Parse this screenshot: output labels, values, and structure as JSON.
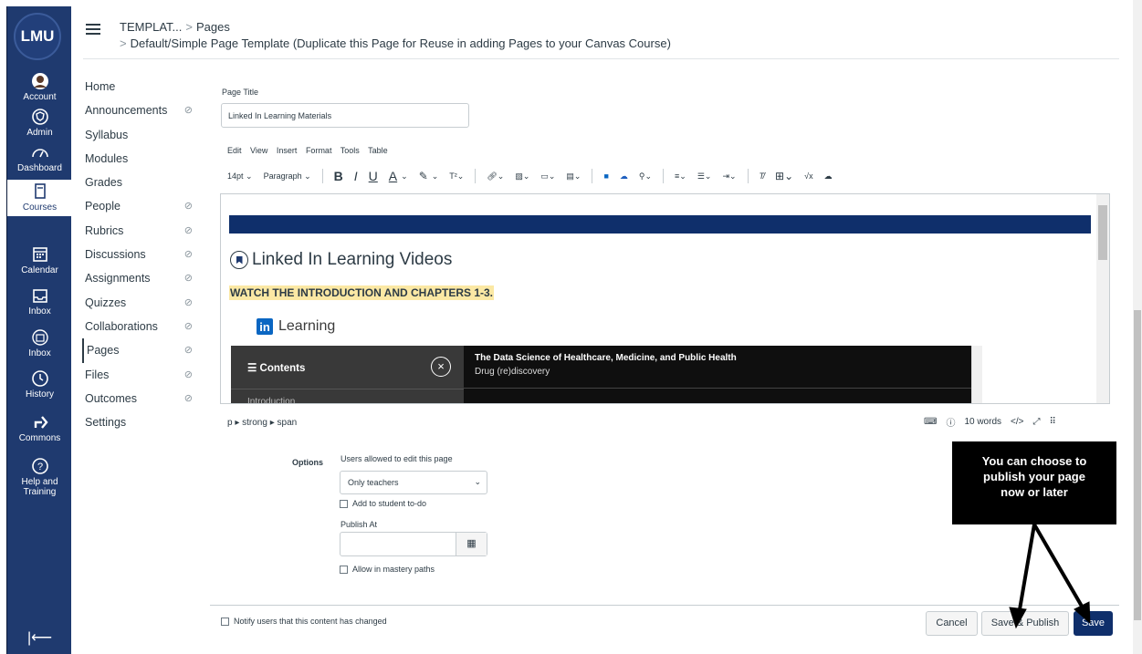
{
  "global_nav": {
    "logo": "LMU",
    "items": [
      {
        "label": "Account",
        "icon": "avatar-icon"
      },
      {
        "label": "Admin",
        "icon": "shield-icon"
      },
      {
        "label": "Dashboard",
        "icon": "dashboard-icon"
      },
      {
        "label": "Courses",
        "icon": "book-icon",
        "active": true
      },
      {
        "label": "Calendar",
        "icon": "calendar-icon"
      },
      {
        "label": "Inbox",
        "icon": "inbox-icon"
      },
      {
        "label": "Inbox",
        "icon": "inbox-icon"
      },
      {
        "label": "History",
        "icon": "clock-icon"
      },
      {
        "label": "Commons",
        "icon": "commons-icon"
      },
      {
        "label": "Help and Training",
        "icon": "help-icon"
      }
    ],
    "collapse": "|⟵"
  },
  "header": {
    "course": "TEMPLAT...",
    "section": "Pages",
    "page": "Default/Simple Page Template (Duplicate this Page for Reuse in adding Pages to your Canvas Course)"
  },
  "course_nav": [
    {
      "label": "Home",
      "hidden": false
    },
    {
      "label": "Announcements",
      "hidden": true
    },
    {
      "label": "Syllabus",
      "hidden": false
    },
    {
      "label": "Modules",
      "hidden": false
    },
    {
      "label": "Grades",
      "hidden": false
    },
    {
      "label": "People",
      "hidden": true
    },
    {
      "label": "Rubrics",
      "hidden": true
    },
    {
      "label": "Discussions",
      "hidden": true
    },
    {
      "label": "Assignments",
      "hidden": true
    },
    {
      "label": "Quizzes",
      "hidden": true
    },
    {
      "label": "Collaborations",
      "hidden": true
    },
    {
      "label": "Pages",
      "hidden": true,
      "active": true
    },
    {
      "label": "Files",
      "hidden": true
    },
    {
      "label": "Outcomes",
      "hidden": true
    },
    {
      "label": "Settings",
      "hidden": false
    }
  ],
  "editor": {
    "title_label": "Page Title",
    "title_value": "Linked In Learning Materials",
    "menubar": [
      "Edit",
      "View",
      "Insert",
      "Format",
      "Tools",
      "Table"
    ],
    "font_size": "14pt",
    "block_format": "Paragraph",
    "content": {
      "heading": "Linked In Learning Videos",
      "highlight": "WATCH THE INTRODUCTION AND CHAPTERS 1-3.",
      "li_word": "Learning",
      "li_badge": "in",
      "contents_label": "Contents",
      "intro_label": "Introduction",
      "course_title": "The Data Science of Healthcare, Medicine, and Public Health",
      "course_sub": "Drug (re)discovery"
    },
    "status_path": "p ▸ strong ▸ span",
    "word_count": "10 words",
    "html_toggle": "</>"
  },
  "options": {
    "label": "Options",
    "edit_label": "Users allowed to edit this page",
    "edit_value": "Only teachers",
    "todo_label": "Add to student to-do",
    "publish_label": "Publish At",
    "publish_value": "",
    "mastery_label": "Allow in mastery paths"
  },
  "footer": {
    "notify_label": "Notify users that this content has changed",
    "cancel": "Cancel",
    "save_publish": "Save & Publish",
    "save": "Save"
  },
  "callout": {
    "line1": "You can choose to",
    "line2": "publish your page",
    "line3": "now or later"
  },
  "colors": {
    "nav_bg": "#1f3a6f",
    "primary": "#0f2f6b",
    "highlight": "#fbe8a4",
    "linkedin": "#0a66c2"
  }
}
